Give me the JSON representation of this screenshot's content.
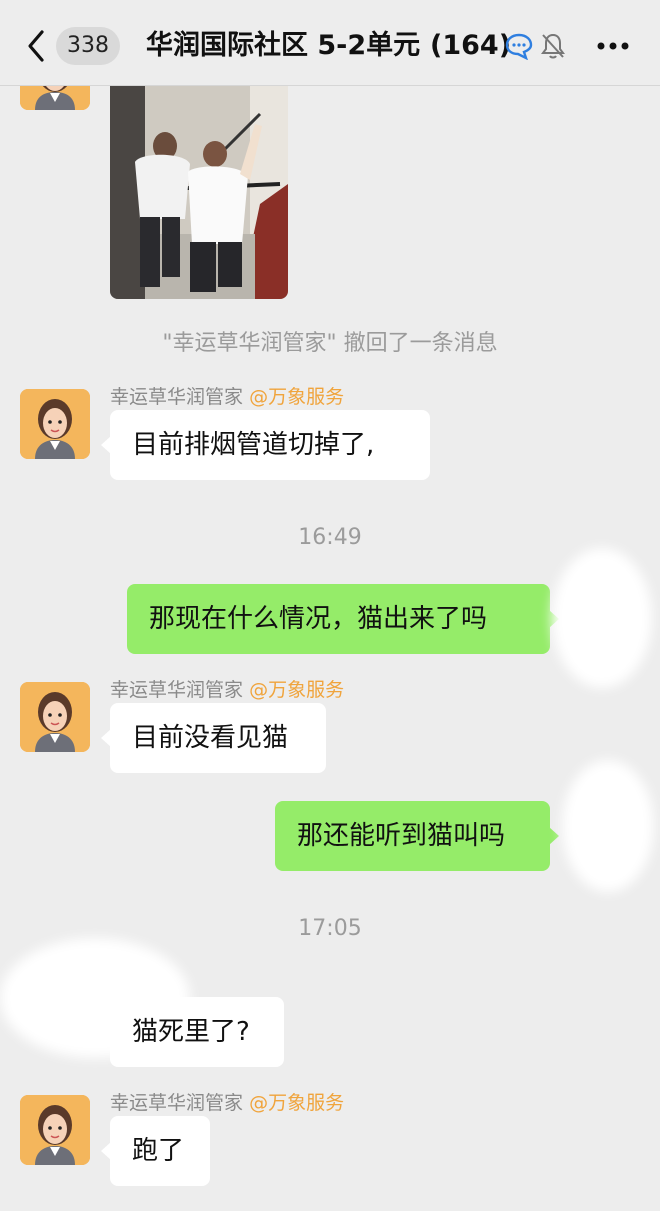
{
  "header": {
    "unread_count": "338",
    "title": "华润国际社区 5-2单元",
    "member_count": "(164)"
  },
  "messages": {
    "recall_notice": "\"幸运草华润管家\" 撤回了一条消息",
    "nick_1": "幸运草华润管家",
    "tag_1": "@万象服务",
    "msg_1": "目前排烟管道切掉了,",
    "time_1": "16:49",
    "msg_2": "那现在什么情况，猫出来了吗",
    "nick_2": "幸运草华润管家",
    "tag_2": "@万象服务",
    "msg_3": "目前没看见猫",
    "msg_4": "那还能听到猫叫吗",
    "time_2": "17:05",
    "msg_5": "猫死里了?",
    "nick_3": "幸运草华润管家",
    "tag_3": "@万象服务",
    "msg_6": "跑了"
  },
  "colors": {
    "outgoing_bubble": "#95ec69",
    "incoming_bubble": "#ffffff",
    "background": "#ededed",
    "tag_orange": "#f0a43c"
  },
  "icons": [
    "back-icon",
    "chat-bubble-icon",
    "mute-bell-icon",
    "more-icon",
    "manager-avatar"
  ]
}
